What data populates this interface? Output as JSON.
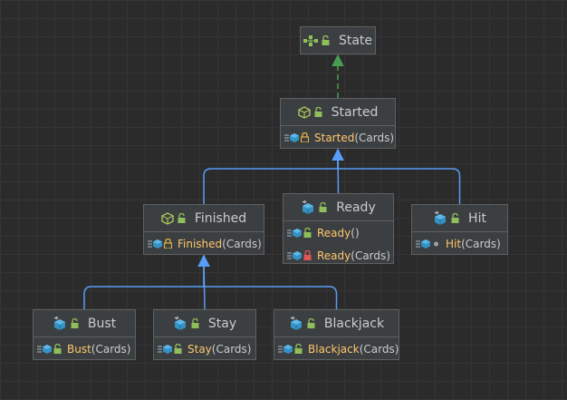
{
  "colors": {
    "background": "#2b2b2b",
    "node_fill": "#3c3f41",
    "node_border": "#5e6060",
    "text": "#c9cbcc",
    "method_name": "#ffc66d",
    "inherit_edge": "#589df6",
    "implements_edge": "#499c54"
  },
  "nodes": [
    {
      "id": "state",
      "name": "State",
      "kind": "interface",
      "icon": "interface-icon",
      "visibility_icon": "public-unlock-icon",
      "members": []
    },
    {
      "id": "started",
      "name": "Started",
      "kind": "abstract-class",
      "icon": "abstract-class-icon",
      "visibility_icon": "public-unlock-icon",
      "members": [
        {
          "name": "Started",
          "params": "(Cards)",
          "icon": "constructor-icon",
          "visibility_icon": "protected-lock-icon"
        }
      ]
    },
    {
      "id": "finished",
      "name": "Finished",
      "kind": "abstract-class",
      "icon": "abstract-class-icon",
      "visibility_icon": "public-unlock-icon",
      "members": [
        {
          "name": "Finished",
          "params": "(Cards)",
          "icon": "constructor-icon",
          "visibility_icon": "protected-lock-icon"
        }
      ]
    },
    {
      "id": "ready",
      "name": "Ready",
      "kind": "class",
      "icon": "class-icon",
      "visibility_icon": "public-unlock-icon",
      "members": [
        {
          "name": "Ready",
          "params": "()",
          "icon": "constructor-icon",
          "visibility_icon": "public-unlock-icon"
        },
        {
          "name": "Ready",
          "params": "(Cards)",
          "icon": "constructor-icon",
          "visibility_icon": "private-lock-icon"
        }
      ]
    },
    {
      "id": "hit",
      "name": "Hit",
      "kind": "class",
      "icon": "class-icon",
      "visibility_icon": "public-unlock-icon",
      "members": [
        {
          "name": "Hit",
          "params": "(Cards)",
          "icon": "constructor-icon",
          "visibility_icon": "package-dot-icon"
        }
      ]
    },
    {
      "id": "bust",
      "name": "Bust",
      "kind": "class",
      "icon": "class-icon",
      "visibility_icon": "public-unlock-icon",
      "members": [
        {
          "name": "Bust",
          "params": "(Cards)",
          "icon": "constructor-icon",
          "visibility_icon": "public-unlock-icon"
        }
      ]
    },
    {
      "id": "stay",
      "name": "Stay",
      "kind": "class",
      "icon": "class-icon",
      "visibility_icon": "public-unlock-icon",
      "members": [
        {
          "name": "Stay",
          "params": "(Cards)",
          "icon": "constructor-icon",
          "visibility_icon": "public-unlock-icon"
        }
      ]
    },
    {
      "id": "blackjack",
      "name": "Blackjack",
      "kind": "class",
      "icon": "class-icon",
      "visibility_icon": "public-unlock-icon",
      "members": [
        {
          "name": "Blackjack",
          "params": "(Cards)",
          "icon": "constructor-icon",
          "visibility_icon": "public-unlock-icon"
        }
      ]
    }
  ],
  "edges": [
    {
      "from": "started",
      "to": "state",
      "type": "implements"
    },
    {
      "from": "finished",
      "to": "started",
      "type": "extends"
    },
    {
      "from": "ready",
      "to": "started",
      "type": "extends"
    },
    {
      "from": "hit",
      "to": "started",
      "type": "extends"
    },
    {
      "from": "bust",
      "to": "finished",
      "type": "extends"
    },
    {
      "from": "stay",
      "to": "finished",
      "type": "extends"
    },
    {
      "from": "blackjack",
      "to": "finished",
      "type": "extends"
    }
  ]
}
